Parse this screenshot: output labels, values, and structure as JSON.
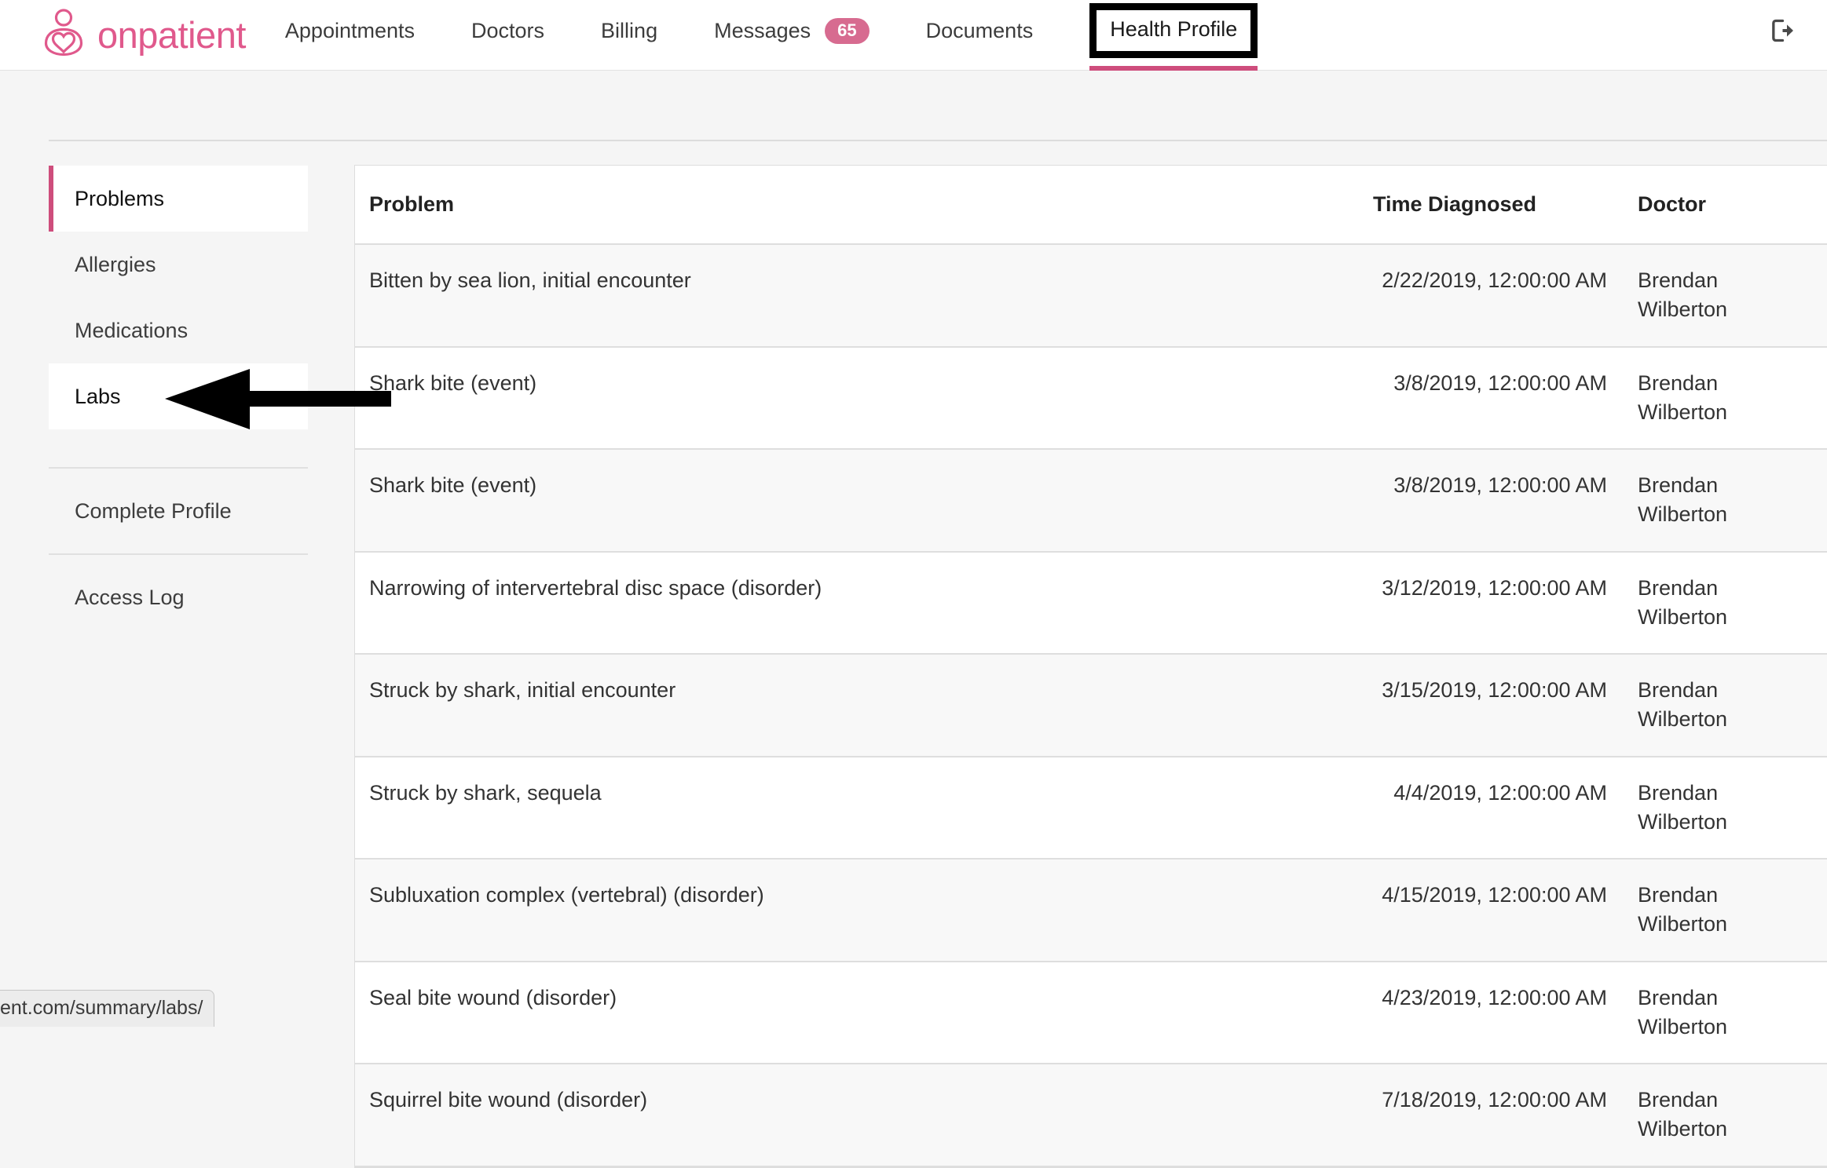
{
  "brand": {
    "name": "onpatient",
    "logo_icon": "onpatient-person-heart-logo"
  },
  "topnav": {
    "items": [
      {
        "label": "Appointments",
        "badge": null,
        "active": false
      },
      {
        "label": "Doctors",
        "badge": null,
        "active": false
      },
      {
        "label": "Billing",
        "badge": null,
        "active": false
      },
      {
        "label": "Messages",
        "badge": "65",
        "active": false
      },
      {
        "label": "Documents",
        "badge": null,
        "active": false
      },
      {
        "label": "Health Profile",
        "badge": null,
        "active": true
      }
    ],
    "logout_icon": "logout-icon"
  },
  "sidebar": {
    "items": [
      {
        "label": "Problems",
        "state": "active"
      },
      {
        "label": "Allergies",
        "state": "default"
      },
      {
        "label": "Medications",
        "state": "default"
      },
      {
        "label": "Labs",
        "state": "hovered"
      },
      {
        "label": "Complete Profile",
        "state": "default"
      },
      {
        "label": "Access Log",
        "state": "default"
      }
    ]
  },
  "table": {
    "columns": [
      "Problem",
      "Time Diagnosed",
      "Doctor"
    ],
    "rows": [
      {
        "problem": "Bitten by sea lion, initial encounter",
        "time": "2/22/2019, 12:00:00 AM",
        "doctor": "Brendan Wilberton"
      },
      {
        "problem": "Shark bite (event)",
        "time": "3/8/2019, 12:00:00 AM",
        "doctor": "Brendan Wilberton"
      },
      {
        "problem": "Shark bite (event)",
        "time": "3/8/2019, 12:00:00 AM",
        "doctor": "Brendan Wilberton"
      },
      {
        "problem": "Narrowing of intervertebral disc space (disorder)",
        "time": "3/12/2019, 12:00:00 AM",
        "doctor": "Brendan Wilberton"
      },
      {
        "problem": "Struck by shark, initial encounter",
        "time": "3/15/2019, 12:00:00 AM",
        "doctor": "Brendan Wilberton"
      },
      {
        "problem": "Struck by shark, sequela",
        "time": "4/4/2019, 12:00:00 AM",
        "doctor": "Brendan Wilberton"
      },
      {
        "problem": "Subluxation complex (vertebral) (disorder)",
        "time": "4/15/2019, 12:00:00 AM",
        "doctor": "Brendan Wilberton"
      },
      {
        "problem": "Seal bite wound (disorder)",
        "time": "4/23/2019, 12:00:00 AM",
        "doctor": "Brendan Wilberton"
      },
      {
        "problem": "Squirrel bite wound (disorder)",
        "time": "7/18/2019, 12:00:00 AM",
        "doctor": "Brendan Wilberton"
      }
    ]
  },
  "statusbar": {
    "url": "ent.com/summary/labs/"
  },
  "annotation": {
    "arrow_target": "Labs",
    "highlight_target": "Health Profile"
  },
  "colors": {
    "brand_pink": "#e0598c",
    "accent_pink": "#ce4d7c",
    "badge_pink": "#d76b90",
    "page_bg": "#f5f5f5",
    "row_stripe": "#f8f8f8",
    "annotation_black": "#000000"
  }
}
